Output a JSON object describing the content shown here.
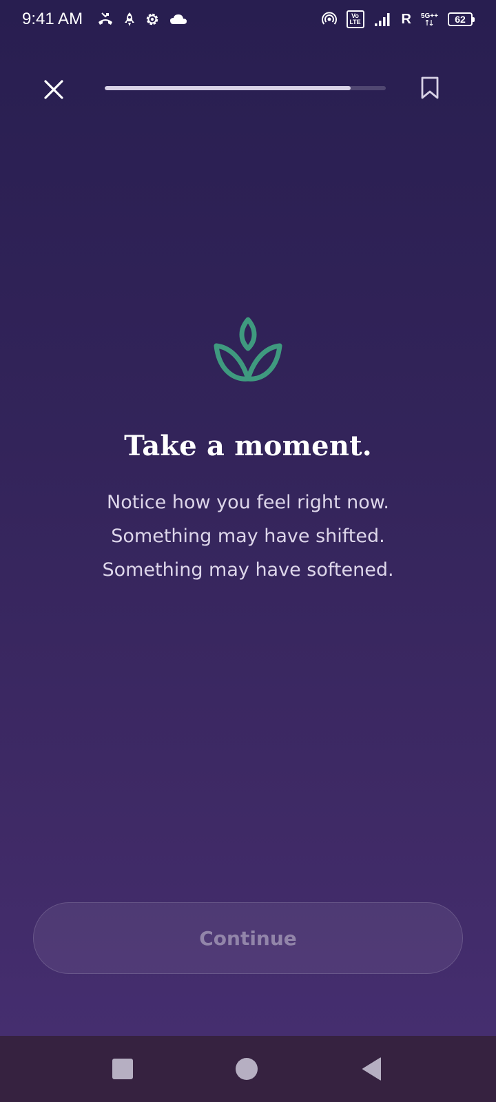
{
  "status_bar": {
    "time": "9:41 AM",
    "roaming_label": "R",
    "network_label": "5G++",
    "volte_top": "Vo",
    "volte_bottom": "LTE",
    "battery_level": "62",
    "icons": [
      "missed-call-icon",
      "rocket-icon",
      "settings-icon",
      "cloud-icon",
      "hotspot-icon",
      "volte-icon",
      "signal-icon",
      "battery-icon"
    ]
  },
  "top_bar": {
    "progress_fraction": 0.875,
    "icons": [
      "close-icon",
      "bookmark-icon"
    ]
  },
  "content": {
    "icon": "lotus-icon",
    "title": "Take a moment.",
    "lines": [
      "Notice how you feel right now.",
      "Something may have shifted.",
      "Something may have softened."
    ]
  },
  "footer": {
    "continue_label": "Continue"
  },
  "nav_bar": {
    "icons": [
      "recent-apps-icon",
      "home-icon",
      "back-icon"
    ]
  },
  "colors": {
    "background_top": "#281e50",
    "background_bottom": "#472f72",
    "accent_green": "#3f9a7f",
    "nav_bar": "#362240"
  }
}
